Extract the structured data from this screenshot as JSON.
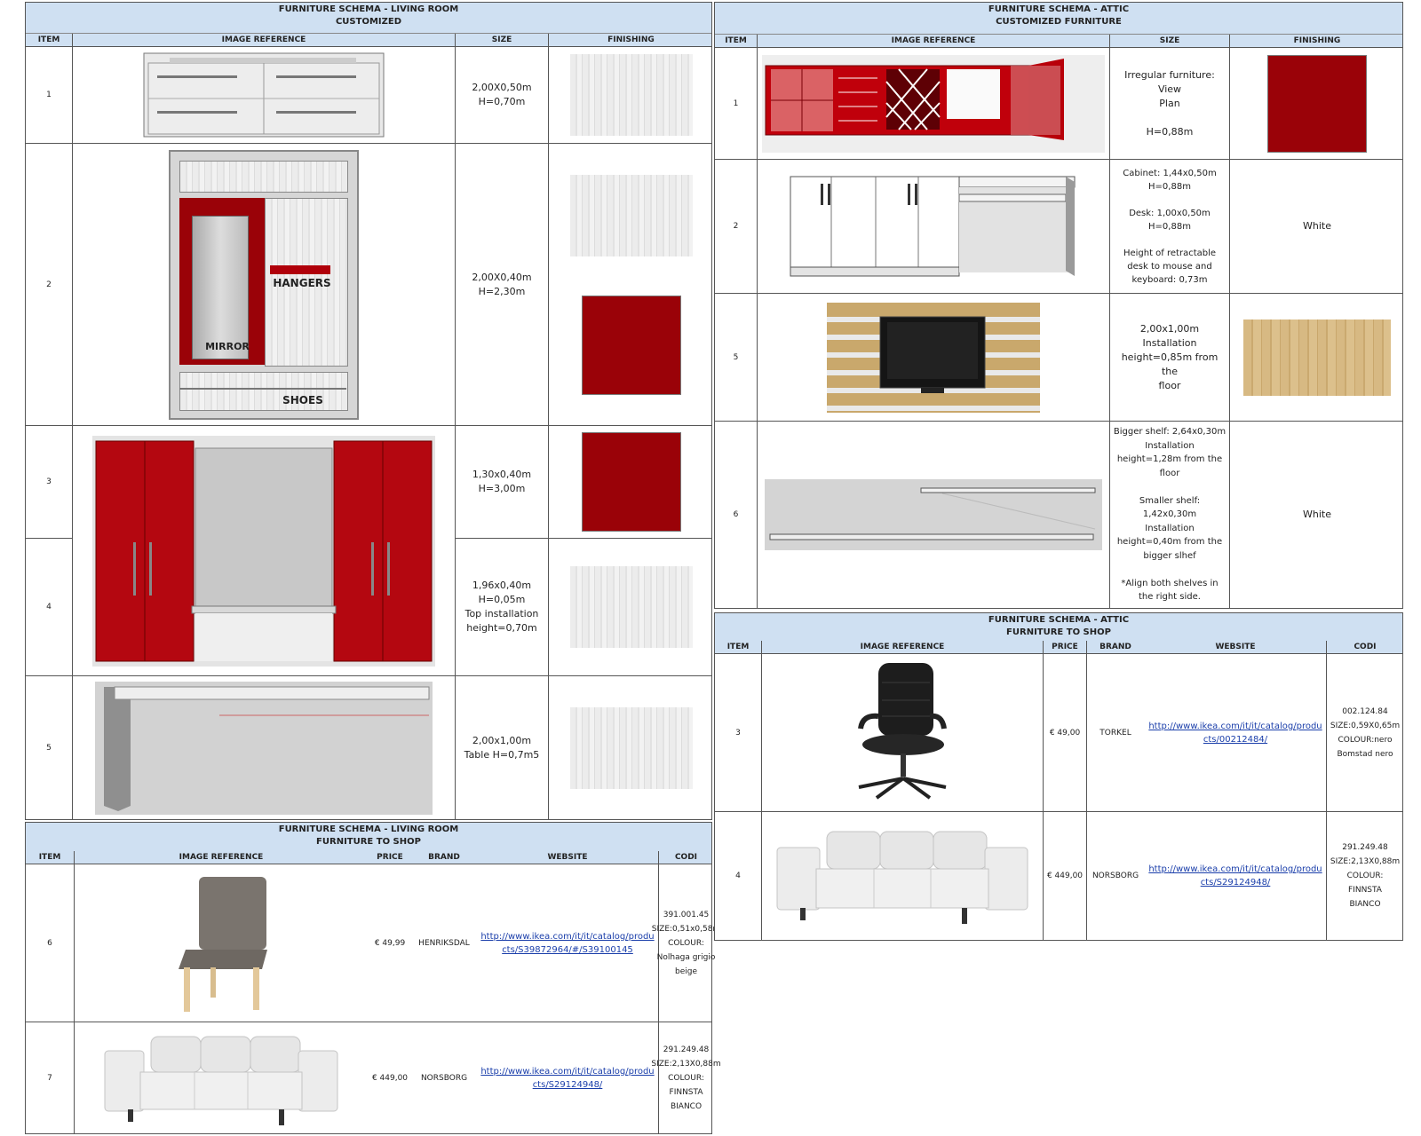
{
  "living_custom": {
    "title1": "FURNITURE SCHEMA - LIVING ROOM",
    "title2": "CUSTOMIZED",
    "headers": [
      "ITEM",
      "IMAGE REFERENCE",
      "SIZE",
      "FINISHING"
    ],
    "rows": [
      {
        "item": "1",
        "size": "2,00X0,50m\nH=0,70m"
      },
      {
        "item": "2",
        "size": "2,00X0,40m\nH=2,30m",
        "labels": [
          "HANGERS",
          "MIRROR",
          "SHOES"
        ]
      },
      {
        "item": "3",
        "size": "1,30x0,40m\nH=3,00m"
      },
      {
        "item": "4",
        "size": "1,96x0,40m\nH=0,05m\nTop installation\nheight=0,70m"
      },
      {
        "item": "5",
        "size": "2,00x1,00m\nTable H=0,7m5"
      }
    ]
  },
  "living_shop": {
    "title1": "FURNITURE SCHEMA - LIVING ROOM",
    "title2": "FURNITURE TO SHOP",
    "headers": [
      "ITEM",
      "IMAGE REFERENCE",
      "PRICE",
      "BRAND",
      "WEBSITE",
      "CODI"
    ],
    "rows": [
      {
        "item": "6",
        "price": "€ 49,99",
        "brand": "HENRIKSDAL",
        "website": "http://www.ikea.com/it/it/catalog/products/S39872964/#/S39100145",
        "code": "391.001.45\nSIZE:0,51x0,58m\nCOLOUR:\nNolhaga grigio\nbeige"
      },
      {
        "item": "7",
        "price": "€ 449,00",
        "brand": "NORSBORG",
        "website": "http://www.ikea.com/it/it/catalog/products/S29124948/",
        "code": "291.249.48\nSIZE:2,13X0,88m\nCOLOUR:\nFINNSTA\nBIANCO"
      }
    ]
  },
  "attic_custom": {
    "title1": "FURNITURE SCHEMA - ATTIC",
    "title2": "CUSTOMIZED FURNITURE",
    "headers": [
      "ITEM",
      "IMAGE REFERENCE",
      "SIZE",
      "FINISHING"
    ],
    "rows": [
      {
        "item": "1",
        "size": "Irregular furniture: View\nPlan\n\nH=0,88m",
        "finishing": ""
      },
      {
        "item": "2",
        "size": "Cabinet: 1,44x0,50m\nH=0,88m\n\nDesk: 1,00x0,50m\nH=0,88m\n\nHeight of retractable\ndesk to mouse and\nkeyboard: 0,73m",
        "finishing": "White"
      },
      {
        "item": "5",
        "size": "2,00x1,00m\nInstallation\nheight=0,85m from the\nfloor",
        "finishing": ""
      },
      {
        "item": "6",
        "size": "Bigger shelf: 2,64x0,30m\nInstallation\nheight=1,28m from the\nfloor\n\nSmaller shelf:\n1,42x0,30m\nInstallation\nheight=0,40m from the\nbigger slhef\n\n*Align both shelves in\nthe right side.",
        "finishing": "White"
      }
    ]
  },
  "attic_shop": {
    "title1": "FURNITURE SCHEMA - ATTIC",
    "title2": "FURNITURE TO SHOP",
    "headers": [
      "ITEM",
      "IMAGE REFERENCE",
      "PRICE",
      "BRAND",
      "WEBSITE",
      "CODI"
    ],
    "rows": [
      {
        "item": "3",
        "price": "€ 49,00",
        "brand": "TORKEL",
        "website": "http://www.ikea.com/it/it/catalog/products/00212484/",
        "code": "002.124.84\nSIZE:0,59X0,65m\nCOLOUR:nero\nBomstad nero"
      },
      {
        "item": "4",
        "price": "€ 449,00",
        "brand": "NORSBORG",
        "website": "http://www.ikea.com/it/it/catalog/products/S29124948/",
        "code": "291.249.48\nSIZE:2,13X0,88m\nCOLOUR:\nFINNSTA\nBIANCO"
      }
    ]
  },
  "colors": {
    "red": "#9a0208",
    "header_blue": "#cfe0f2",
    "link": "#1a3eaa"
  }
}
